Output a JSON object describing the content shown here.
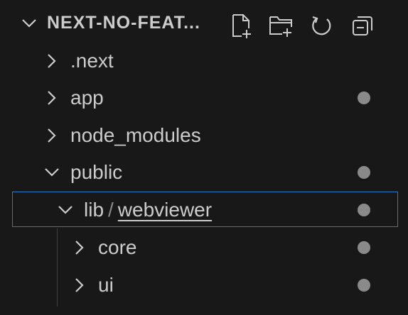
{
  "explorer": {
    "section_title": "NEXT-NO-FEAT...",
    "header_actions": [
      {
        "name": "new-file-icon"
      },
      {
        "name": "new-folder-icon"
      },
      {
        "name": "refresh-icon"
      },
      {
        "name": "collapse-all-icon"
      }
    ],
    "tree": [
      {
        "label": ".next",
        "expanded": false,
        "depth": 1,
        "modified_dot": false
      },
      {
        "label": "app",
        "expanded": false,
        "depth": 1,
        "modified_dot": true
      },
      {
        "label": "node_modules",
        "expanded": false,
        "depth": 1,
        "modified_dot": false
      },
      {
        "label": "public",
        "expanded": true,
        "depth": 1,
        "modified_dot": true
      },
      {
        "label_prefix": "lib",
        "label_separator": "/",
        "label_suffix": "webviewer",
        "expanded": true,
        "depth": 2,
        "modified_dot": true,
        "selected": true
      },
      {
        "label": "core",
        "expanded": false,
        "depth": 3,
        "modified_dot": true
      },
      {
        "label": "ui",
        "expanded": false,
        "depth": 3,
        "modified_dot": true
      }
    ]
  },
  "colors": {
    "background": "#181818",
    "text": "#cccccc",
    "dot": "#8a8a8a",
    "focus_border": "#2a79c7"
  }
}
